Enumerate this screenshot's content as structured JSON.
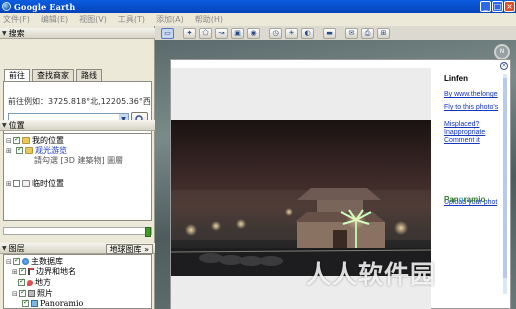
{
  "window": {
    "title": "Google Earth",
    "buttons": [
      "_",
      "□",
      "×"
    ]
  },
  "menu": [
    "文件(F)",
    "编辑(E)",
    "视图(V)",
    "工具(T)",
    "添加(A)",
    "帮助(H)"
  ],
  "search_panel": {
    "header": "搜索",
    "tabs": [
      "前往",
      "查找商家",
      "路线"
    ],
    "active_tab": 0,
    "hint": "前往例如：3725.818°北,12205.36°西",
    "input_value": ""
  },
  "places_panel": {
    "header": "位置",
    "items": [
      {
        "label": "我的位置"
      },
      {
        "label": "观光游览"
      },
      {
        "label": "請勾選 [3D 建築物] 圖層"
      },
      {
        "label": "临时位置"
      }
    ]
  },
  "layers_panel": {
    "header": "图层",
    "gallery_button": "地球图库 »",
    "items": [
      {
        "label": "主数据库"
      },
      {
        "label": "边界和地名"
      },
      {
        "label": "地方"
      },
      {
        "label": "照片"
      },
      {
        "label": "Panoramio"
      }
    ]
  },
  "popup": {
    "place_name": "Linfen",
    "links": [
      "By www.thelonge",
      "Fly to this photo's",
      "Misplaced?",
      "Inappropriate",
      "Comment it",
      "Upload your phot"
    ],
    "logo_text_a": "Pan",
    "logo_text_o": "o",
    "logo_text_b": "ramio"
  },
  "watermark": "人人软件园"
}
